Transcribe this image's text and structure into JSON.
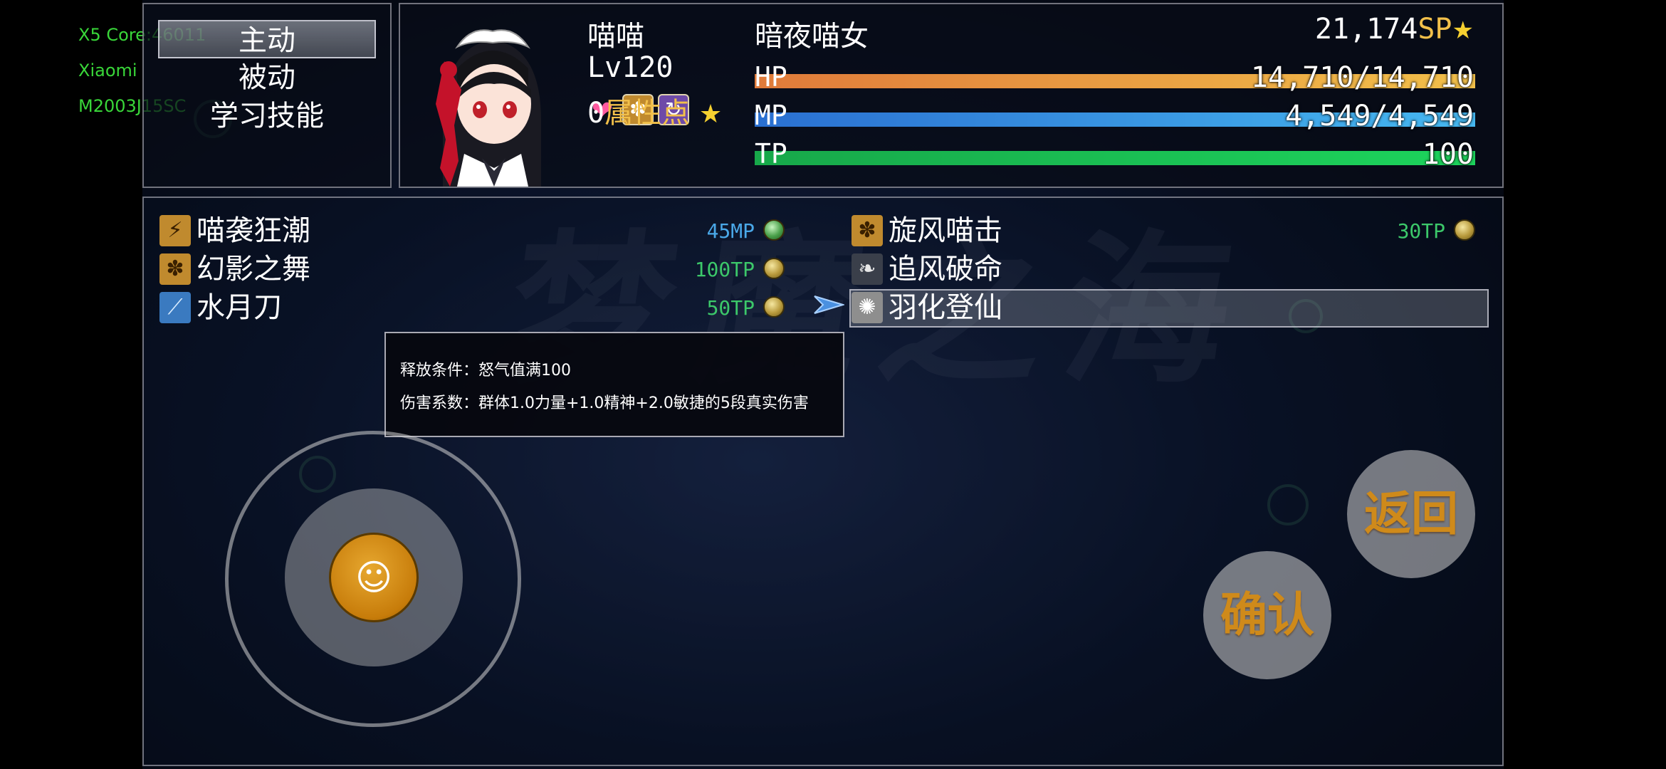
{
  "device_info": [
    "X5 Core:46011",
    "Xiaomi",
    "M2003J15SC"
  ],
  "commands": [
    {
      "label": "主动",
      "selected": true
    },
    {
      "label": "被动",
      "selected": false
    },
    {
      "label": "学习技能",
      "selected": false
    }
  ],
  "actor": {
    "name": "喵喵",
    "class": "暗夜喵女",
    "level": "Lv120",
    "sp_value": "21,174",
    "sp_label": "SP",
    "attr_points": "0",
    "attr_label": "属性点",
    "hp": {
      "label": "HP",
      "value": "14,710/14,710",
      "ratio": 1.0
    },
    "mp": {
      "label": "MP",
      "value": "4,549/4,549",
      "ratio": 1.0
    },
    "tp": {
      "label": "TP",
      "value": "100",
      "ratio": 1.0
    },
    "state_icons": [
      "heart-icon",
      "paw-icon",
      "swirl-icon"
    ]
  },
  "skills": [
    {
      "name": "喵袭狂潮",
      "cost": "45MP",
      "cost_type": "mp",
      "icon": "claw-icon"
    },
    {
      "name": "旋风喵击",
      "cost": "30TP",
      "cost_type": "tp",
      "icon": "paw-icon"
    },
    {
      "name": "幻影之舞",
      "cost": "100TP",
      "cost_type": "tp",
      "icon": "paw-icon"
    },
    {
      "name": "追风破命",
      "cost": "",
      "cost_type": "",
      "icon": "wing-icon"
    },
    {
      "name": "水月刀",
      "cost": "50TP",
      "cost_type": "tp",
      "icon": "blade-icon"
    },
    {
      "name": "羽化登仙",
      "cost": "",
      "cost_type": "",
      "icon": "radiance-icon",
      "selected": true
    }
  ],
  "tooltip": {
    "line1": "释放条件：怒气值满100",
    "line2": "伤害系数：群体1.0力量+1.0精神+2.0敏捷的5段真实伤害"
  },
  "buttons": {
    "back": "返回",
    "confirm": "确认"
  },
  "colors": {
    "hp_gradient": [
      "#e07a3a",
      "#f2c04a"
    ],
    "mp_gradient": [
      "#2a6fd1",
      "#46b8f0"
    ],
    "tp_gradient": [
      "#17a84a",
      "#1dd45c"
    ],
    "sp_label": "#f2c04a",
    "mp_cost": "#4aa8e8",
    "tp_cost": "#3cc86a",
    "button_text": "#cf8a1a"
  }
}
